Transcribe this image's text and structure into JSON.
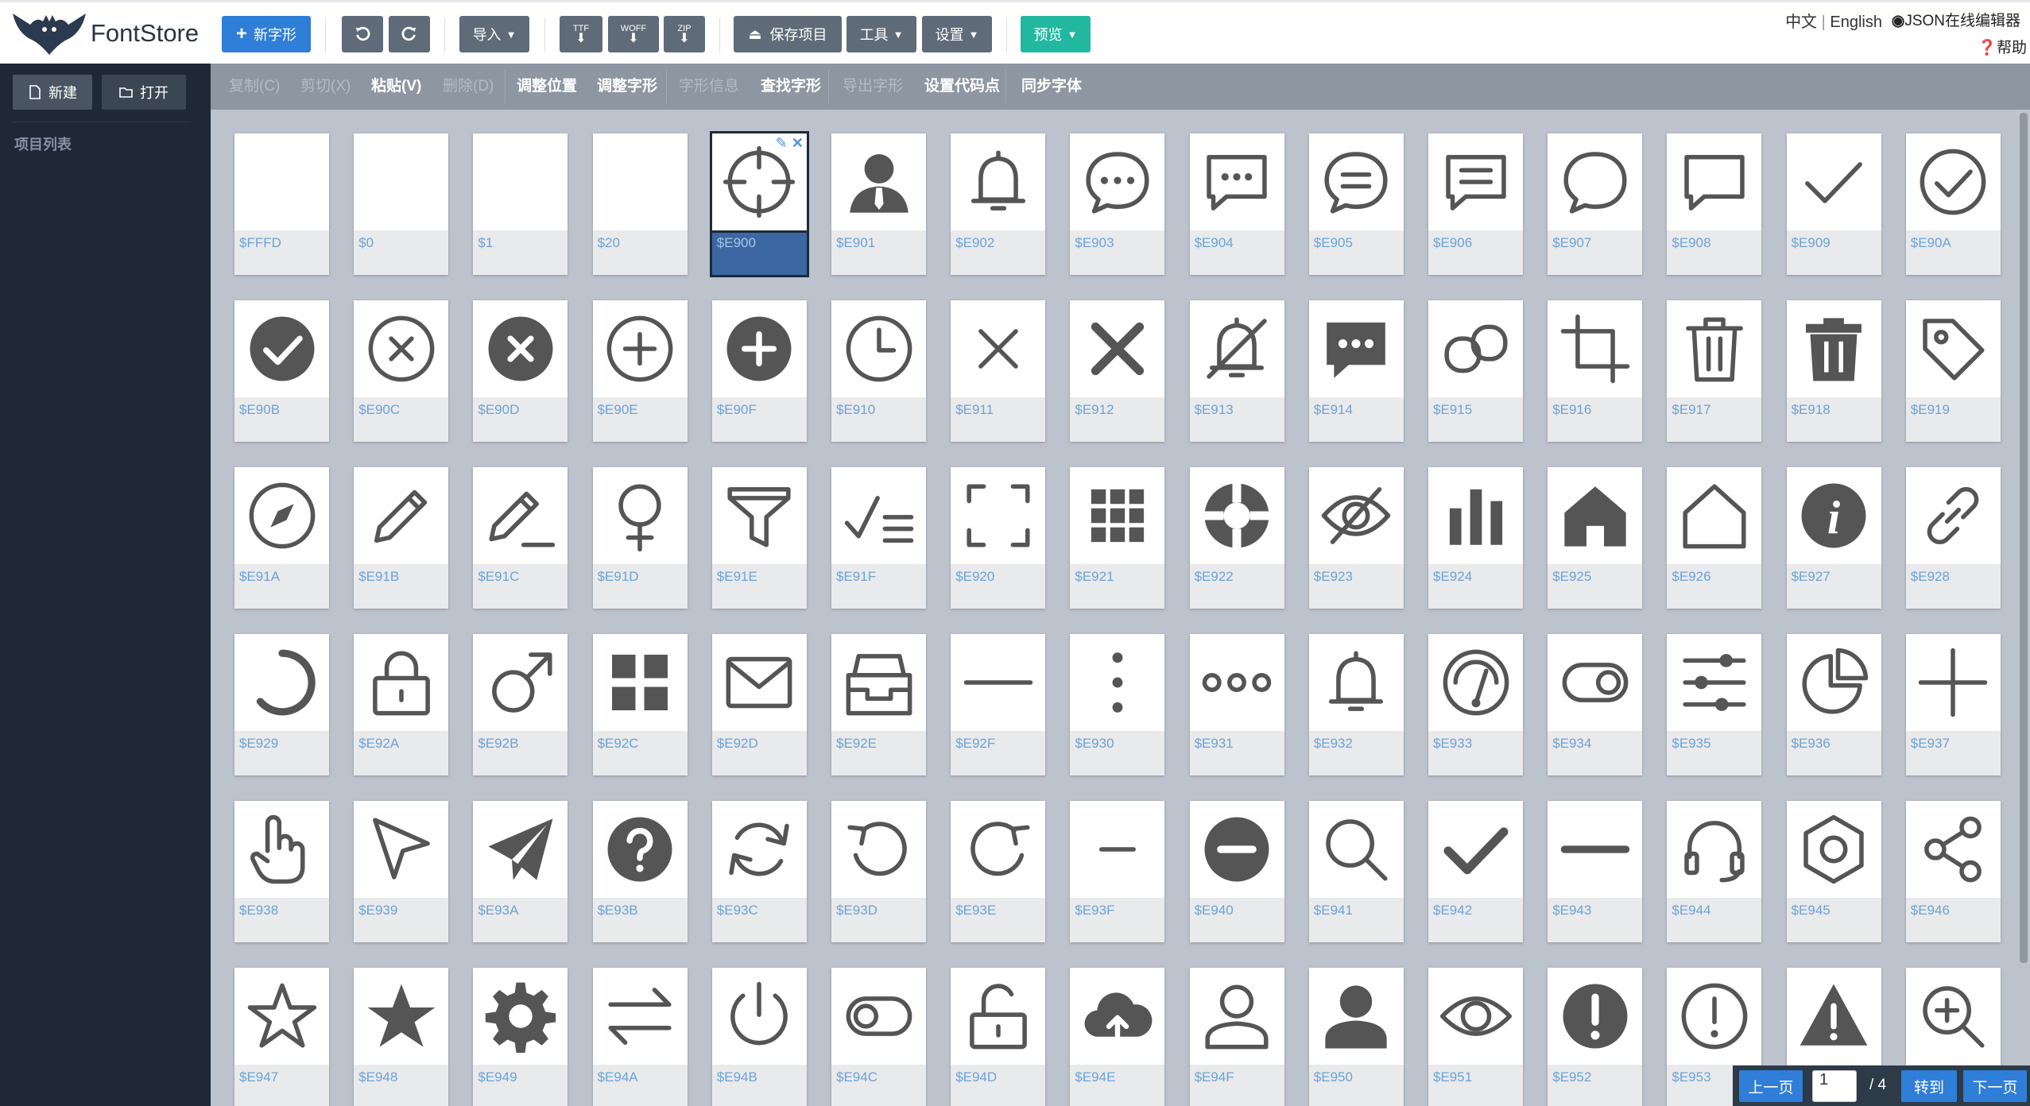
{
  "app": {
    "name": "FontStore"
  },
  "toolbar": {
    "new_glyph": "新字形",
    "undo_icon": "undo-icon",
    "redo_icon": "redo-icon",
    "import": "导入",
    "export_ttf": "TTF",
    "export_woff": "WOFF",
    "export_zip": "ZIP",
    "save_project": "保存项目",
    "tools": "工具",
    "settings": "设置",
    "preview": "预览"
  },
  "header_links": {
    "lang_zh": "中文",
    "lang_sep": "|",
    "lang_en": "English",
    "json_editor": "JSON在线编辑器",
    "help": "帮助"
  },
  "sidebar": {
    "new": "新建",
    "open": "打开",
    "project_list": "项目列表"
  },
  "editbar": [
    {
      "label": "复制(C)",
      "enabled": false
    },
    {
      "label": "剪切(X)",
      "enabled": false
    },
    {
      "label": "粘贴(V)",
      "enabled": true
    },
    {
      "label": "删除(D)",
      "enabled": false
    },
    {
      "label": "调整位置",
      "enabled": true
    },
    {
      "label": "调整字形",
      "enabled": true
    },
    {
      "label": "字形信息",
      "enabled": false
    },
    {
      "label": "查找字形",
      "enabled": true
    },
    {
      "label": "导出字形",
      "enabled": false
    },
    {
      "label": "设置代码点",
      "enabled": true
    },
    {
      "label": "同步字体",
      "enabled": true
    }
  ],
  "glyphs": [
    {
      "code": "$FFFD",
      "icon": "blank"
    },
    {
      "code": "$0",
      "icon": "blank"
    },
    {
      "code": "$1",
      "icon": "blank"
    },
    {
      "code": "$20",
      "icon": "blank"
    },
    {
      "code": "$E900",
      "icon": "crosshair",
      "selected": true
    },
    {
      "code": "$E901",
      "icon": "user-tie"
    },
    {
      "code": "$E902",
      "icon": "bell"
    },
    {
      "code": "$E903",
      "icon": "chat-dots"
    },
    {
      "code": "$E904",
      "icon": "chat-square-dots"
    },
    {
      "code": "$E905",
      "icon": "chat-lines"
    },
    {
      "code": "$E906",
      "icon": "chat-square-lines"
    },
    {
      "code": "$E907",
      "icon": "chat"
    },
    {
      "code": "$E908",
      "icon": "chat-square"
    },
    {
      "code": "$E909",
      "icon": "check"
    },
    {
      "code": "$E90A",
      "icon": "check-circle"
    },
    {
      "code": "$E90B",
      "icon": "check-circle-fill"
    },
    {
      "code": "$E90C",
      "icon": "x-circle"
    },
    {
      "code": "$E90D",
      "icon": "x-circle-fill"
    },
    {
      "code": "$E90E",
      "icon": "plus-circle"
    },
    {
      "code": "$E90F",
      "icon": "plus-circle-fill"
    },
    {
      "code": "$E910",
      "icon": "clock"
    },
    {
      "code": "$E911",
      "icon": "x"
    },
    {
      "code": "$E912",
      "icon": "x-bold"
    },
    {
      "code": "$E913",
      "icon": "bell-off"
    },
    {
      "code": "$E914",
      "icon": "chat-fill"
    },
    {
      "code": "$E915",
      "icon": "link-squares"
    },
    {
      "code": "$E916",
      "icon": "crop"
    },
    {
      "code": "$E917",
      "icon": "trash"
    },
    {
      "code": "$E918",
      "icon": "trash-fill"
    },
    {
      "code": "$E919",
      "icon": "tag"
    },
    {
      "code": "$E91A",
      "icon": "compass"
    },
    {
      "code": "$E91B",
      "icon": "pencil"
    },
    {
      "code": "$E91C",
      "icon": "pencil-line"
    },
    {
      "code": "$E91D",
      "icon": "female"
    },
    {
      "code": "$E91E",
      "icon": "filter"
    },
    {
      "code": "$E91F",
      "icon": "check-list"
    },
    {
      "code": "$E920",
      "icon": "fullscreen"
    },
    {
      "code": "$E921",
      "icon": "grid"
    },
    {
      "code": "$E922",
      "icon": "lifebuoy"
    },
    {
      "code": "$E923",
      "icon": "eye-off"
    },
    {
      "code": "$E924",
      "icon": "bar-chart"
    },
    {
      "code": "$E925",
      "icon": "home-fill"
    },
    {
      "code": "$E926",
      "icon": "home"
    },
    {
      "code": "$E927",
      "icon": "info-fill"
    },
    {
      "code": "$E928",
      "icon": "link"
    },
    {
      "code": "$E929",
      "icon": "spinner"
    },
    {
      "code": "$E92A",
      "icon": "lock"
    },
    {
      "code": "$E92B",
      "icon": "male"
    },
    {
      "code": "$E92C",
      "icon": "apps"
    },
    {
      "code": "$E92D",
      "icon": "mail"
    },
    {
      "code": "$E92E",
      "icon": "inbox"
    },
    {
      "code": "$E92F",
      "icon": "minus-long"
    },
    {
      "code": "$E930",
      "icon": "more-vertical"
    },
    {
      "code": "$E931",
      "icon": "more-horizontal"
    },
    {
      "code": "$E932",
      "icon": "bell"
    },
    {
      "code": "$E933",
      "icon": "gauge"
    },
    {
      "code": "$E934",
      "icon": "toggle"
    },
    {
      "code": "$E935",
      "icon": "sliders"
    },
    {
      "code": "$E936",
      "icon": "pie"
    },
    {
      "code": "$E937",
      "icon": "plus"
    },
    {
      "code": "$E938",
      "icon": "hand"
    },
    {
      "code": "$E939",
      "icon": "cursor"
    },
    {
      "code": "$E93A",
      "icon": "send"
    },
    {
      "code": "$E93B",
      "icon": "question-fill"
    },
    {
      "code": "$E93C",
      "icon": "sync"
    },
    {
      "code": "$E93D",
      "icon": "undo"
    },
    {
      "code": "$E93E",
      "icon": "redo"
    },
    {
      "code": "$E93F",
      "icon": "minus"
    },
    {
      "code": "$E940",
      "icon": "minus-circle-fill"
    },
    {
      "code": "$E941",
      "icon": "search"
    },
    {
      "code": "$E942",
      "icon": "check-bold"
    },
    {
      "code": "$E943",
      "icon": "minus-bold"
    },
    {
      "code": "$E944",
      "icon": "headphones"
    },
    {
      "code": "$E945",
      "icon": "hex-nut"
    },
    {
      "code": "$E946",
      "icon": "share"
    },
    {
      "code": "$E947",
      "icon": "star"
    },
    {
      "code": "$E948",
      "icon": "star-fill"
    },
    {
      "code": "$E949",
      "icon": "gear"
    },
    {
      "code": "$E94A",
      "icon": "swap"
    },
    {
      "code": "$E94B",
      "icon": "power"
    },
    {
      "code": "$E94C",
      "icon": "toggle-off"
    },
    {
      "code": "$E94D",
      "icon": "unlock"
    },
    {
      "code": "$E94E",
      "icon": "cloud-upload"
    },
    {
      "code": "$E94F",
      "icon": "user"
    },
    {
      "code": "$E950",
      "icon": "user-fill"
    },
    {
      "code": "$E951",
      "icon": "eye"
    },
    {
      "code": "$E952",
      "icon": "alert-fill"
    },
    {
      "code": "$E953",
      "icon": "alert"
    },
    {
      "code": "",
      "icon": "warning-fill"
    },
    {
      "code": "",
      "icon": "zoom-in"
    }
  ],
  "pager": {
    "prev": "上一页",
    "page": "1",
    "total": "/ 4",
    "goto": "转到",
    "next": "下一页"
  },
  "colors": {
    "accent_blue": "#2f7ed8",
    "preview_green": "#22b8a0",
    "glyph": "#555555",
    "code_text": "#6ba3d6"
  }
}
